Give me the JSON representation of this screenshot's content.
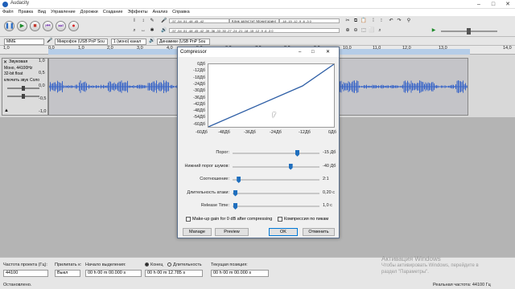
{
  "window": {
    "title": "Audacity"
  },
  "menu": [
    "Файл",
    "Правка",
    "Вид",
    "Управление",
    "Дорожки",
    "Создание",
    "Эффекты",
    "Анализ",
    "Справка"
  ],
  "meters": {
    "rec_scale": "-57  -54  -51  -48  -45  -42",
    "rec_hint": "Клик запустит Мониторинг",
    "rec_scale2": "-18  -15  -12  -9  -6  -3  0",
    "play_scale": "-57  -54  -51  -48  -45  -42  -39  -36  -33  -30  -27  -24  -21  -18  -15  -12  -9  -6  -3  0"
  },
  "devices": {
    "host": "MME",
    "mic": "Микрофон (USB PnP Sou",
    "channels": "1 (моно) канал",
    "output": "Динамики (USB PnP Sou"
  },
  "ruler": {
    "ticks": [
      "1,0",
      "0,0",
      "1,0",
      "2,0",
      "3,0",
      "4,0",
      "5,0",
      "6,0",
      "7,0",
      "8,0",
      "9,0",
      "10,0",
      "11,0",
      "12,0",
      "13,0",
      "14,0"
    ]
  },
  "track": {
    "name": "Звуковая",
    "info1": "Моно, 44100Hz",
    "info2": "32-bit float",
    "info3": "ключить звук",
    "info4": "Соло",
    "scale": [
      "1,0",
      "0,5",
      "0,0",
      "-0,5",
      "-1,0"
    ]
  },
  "dialog": {
    "title": "Compressor",
    "graph_y": [
      "0Дб",
      "-12Дб",
      "-18Дб",
      "-24Дб",
      "-30Дб",
      "-36Дб",
      "-42Дб",
      "-48Дб",
      "-54Дб",
      "-60Дб"
    ],
    "graph_y2": [
      "-6Дб"
    ],
    "graph_x": [
      "-60Дб",
      "-48Дб",
      "-36Дб",
      "-24Дб",
      "-12Дб",
      "0Дб"
    ],
    "params": [
      {
        "label": "Порог:",
        "value": "-15 Дб",
        "level": 0.75
      },
      {
        "label": "Нижний порог шумов:",
        "value": "-40 Дб",
        "level": 0.67
      },
      {
        "label": "Соотношение:",
        "value": "2:1",
        "level": 0.05
      },
      {
        "label": "Длительность атаки:",
        "value": "0,20 с",
        "level": 0.01
      },
      {
        "label": "Release Time:",
        "value": "1,0 с",
        "level": 0.01
      }
    ],
    "makeup_label": "Make-up gain for 0 dB after compressing",
    "peaks_label": "Компрессия по пикам",
    "buttons": {
      "manage": "Manage",
      "preview": "Preview",
      "ok": "OK",
      "cancel": "Отменить"
    }
  },
  "status": {
    "rate_label": "Частота проекта (Гц):",
    "rate_value": "44100",
    "snap_label": "Прилипать к:",
    "snap_value": "Выкл",
    "sel_start_label": "Начало выделения:",
    "sel_start_value": "00 h 00 m 00.000 s",
    "end_label": "Конец",
    "length_label": "Длительность",
    "end_value": "00 h 00 m 12.785 s",
    "pos_label": "Текущая позиция:",
    "pos_value": "00 h 00 m 00.000 s",
    "state": "Остановлено.",
    "actual_rate": "Реальная частота: 44100 Гц",
    "watermark1": "Активация Windows",
    "watermark2": "Чтобы активировать Windows, перейдите в",
    "watermark3": "раздел \"Параметры\"."
  }
}
